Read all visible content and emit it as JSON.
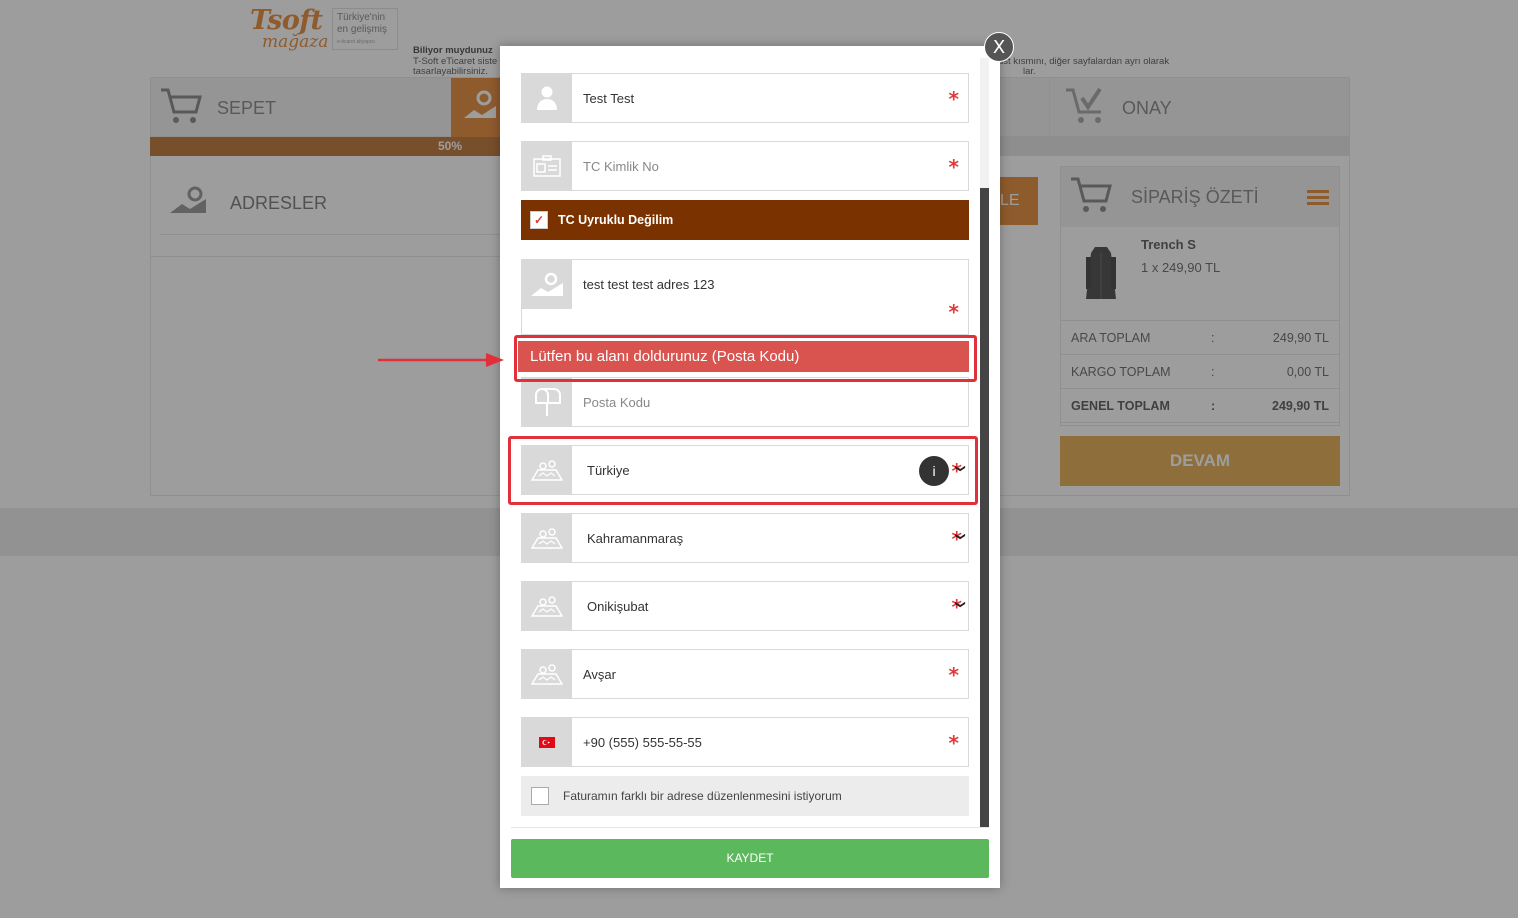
{
  "logo": {
    "brand": "Tsoft",
    "sub": "mağaza",
    "tagline_1": "Türkiye'nin",
    "tagline_2": "en gelişmiş",
    "tagline_3": "e-ticaret altyapısı"
  },
  "info": {
    "title": "Biliyor muydunuz",
    "line1": "T-Soft eTicaret siste",
    "line2": "tasarlayabilirsiniz.",
    "right1": "üst kısmını, diğer sayfalardan ayrı olarak",
    "right2": "lar."
  },
  "steps": {
    "sepet": "SEPET",
    "onay": "ONAY"
  },
  "progress": {
    "label": "50%",
    "value": 0.5
  },
  "adresler": {
    "label": "ADRESLER"
  },
  "orange_button": {
    "label": "LE"
  },
  "summary": {
    "title": "SİPARİŞ ÖZETİ",
    "product": {
      "name": "Trench S",
      "qty_price": "1 x 249,90 TL"
    },
    "rows": [
      {
        "key": "ARA TOPLAM",
        "colon": ":",
        "value": "249,90 TL"
      },
      {
        "key": "KARGO TOPLAM",
        "colon": ":",
        "value": "0,00 TL"
      },
      {
        "key": "GENEL TOPLAM",
        "colon": ":",
        "value": "249,90 TL"
      }
    ],
    "devam": "DEVAM"
  },
  "modal": {
    "close": "X",
    "name": {
      "value": "Test Test",
      "required": "*"
    },
    "tc": {
      "placeholder": "TC Kimlik No",
      "required": "*"
    },
    "tc_check": {
      "label": "TC Uyruklu Değilim",
      "checked": true,
      "mark": "✓"
    },
    "address": {
      "value": "test test test adres 123",
      "required": "*"
    },
    "error": "Lütfen bu alanı doldurunuz (Posta Kodu)",
    "posta": {
      "placeholder": "Posta Kodu"
    },
    "country": {
      "value": "Türkiye",
      "required": "*",
      "chevron": "❯",
      "info": "i"
    },
    "city": {
      "value": "Kahramanmaraş",
      "required": "*",
      "chevron": "❯"
    },
    "district": {
      "value": "Onikişubat",
      "required": "*",
      "chevron": "❯"
    },
    "neighborhood": {
      "value": "Avşar",
      "required": "*"
    },
    "phone": {
      "value": "+90 (555) 555-55-55",
      "required": "*"
    },
    "fatura": {
      "label": "Faturamın farklı bir adrese düzenlenmesini istiyorum",
      "checked": false
    },
    "save": "KAYDET"
  },
  "colors": {
    "accent": "#e07a1f",
    "progress": "#b5621a",
    "tc_bar": "#7a3300",
    "error": "#d9534f",
    "save": "#5cb85c",
    "devam": "#e0a33a"
  },
  "icons": [
    "cart-icon",
    "map-pin-icon",
    "check-cart-icon",
    "menu-icon",
    "user-icon",
    "id-card-icon",
    "mailbox-icon",
    "map-icon",
    "flag-icon",
    "close-icon",
    "info-icon"
  ]
}
